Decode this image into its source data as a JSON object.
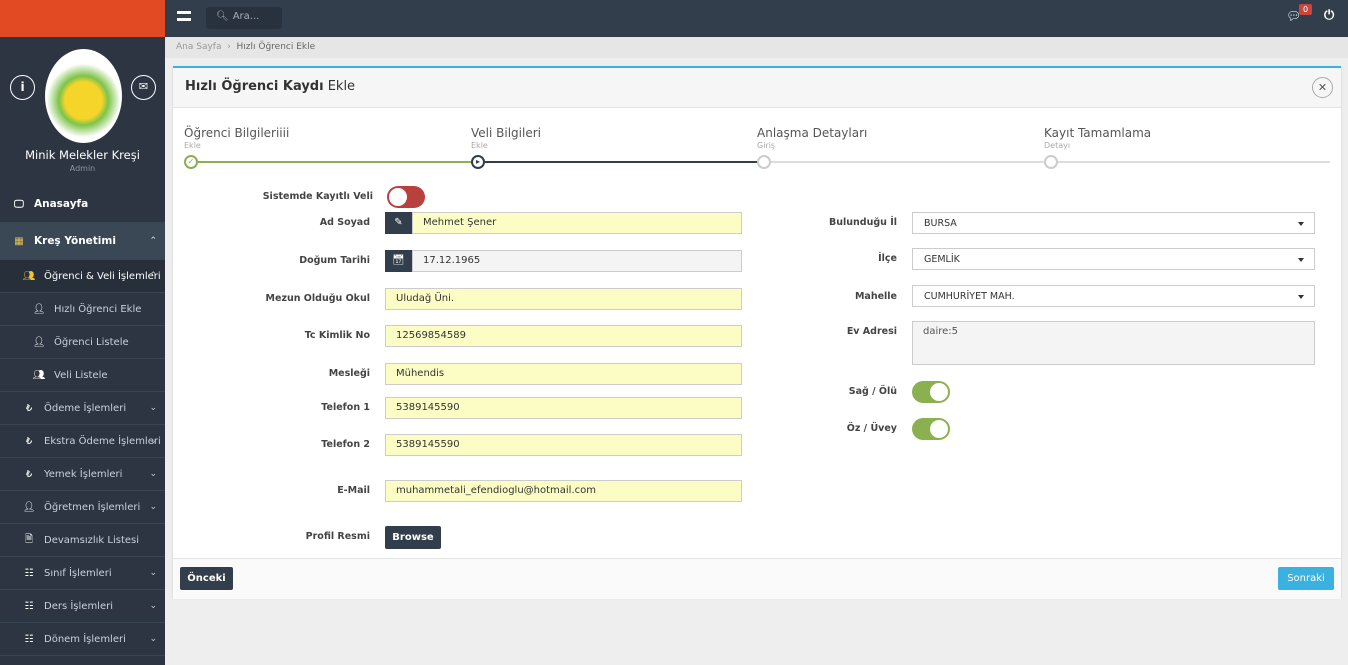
{
  "topbar": {
    "search_placeholder": "Ara...",
    "notification_count": "0"
  },
  "profile": {
    "name": "Minik Melekler Kreşi",
    "role": "Admin"
  },
  "sidebar": {
    "items": [
      {
        "label": "Anasayfa",
        "icon": "desktop-icon"
      },
      {
        "label": "Kreş Yönetimi",
        "icon": "building-icon"
      },
      {
        "label": "Öğrenci & Veli İşlemleri",
        "icon": "users-icon"
      },
      {
        "label": "Hızlı Öğrenci Ekle",
        "icon": "user-icon"
      },
      {
        "label": "Öğrenci Listele",
        "icon": "user-icon"
      },
      {
        "label": "Veli Listele",
        "icon": "users-icon"
      },
      {
        "label": "Ödeme İşlemleri",
        "icon": "lira-icon"
      },
      {
        "label": "Ekstra Ödeme İşlemleri",
        "icon": "lira-icon"
      },
      {
        "label": "Yemek İşlemleri",
        "icon": "lira-icon"
      },
      {
        "label": "Öğretmen İşlemleri",
        "icon": "user-icon"
      },
      {
        "label": "Devamsızlık Listesi",
        "icon": "file-icon"
      },
      {
        "label": "Sınıf İşlemleri",
        "icon": "sitemap-icon"
      },
      {
        "label": "Ders İşlemleri",
        "icon": "sitemap-icon"
      },
      {
        "label": "Dönem İşlemleri",
        "icon": "sitemap-icon"
      }
    ]
  },
  "breadcrumb": {
    "home": "Ana Sayfa",
    "current": "Hızlı Öğrenci Ekle"
  },
  "panel": {
    "title_bold": "Hızlı Öğrenci Kaydı",
    "title_rest": "Ekle"
  },
  "steps": [
    {
      "title": "Öğrenci Bilgileriiii",
      "sub": "Ekle",
      "state": "done"
    },
    {
      "title": "Veli Bilgileri",
      "sub": "Ekle",
      "state": "active"
    },
    {
      "title": "Anlaşma Detayları",
      "sub": "Giriş",
      "state": "pending"
    },
    {
      "title": "Kayıt Tamamlama",
      "sub": "Detayı",
      "state": "pending"
    }
  ],
  "form": {
    "registered_parent": {
      "label": "Sistemde Kayıtlı Veli",
      "on": false
    },
    "name": {
      "label": "Ad Soyad",
      "value": "Mehmet Şener"
    },
    "birth": {
      "label": "Doğum Tarihi",
      "value": "17.12.1965"
    },
    "school": {
      "label": "Mezun Olduğu Okul",
      "value": "Uludağ Üni."
    },
    "tc": {
      "label": "Tc Kimlik No",
      "value": "12569854589"
    },
    "job": {
      "label": "Mesleği",
      "value": "Mühendis"
    },
    "phone1": {
      "label": "Telefon 1",
      "value": "5389145590"
    },
    "phone2": {
      "label": "Telefon 2",
      "value": "5389145590"
    },
    "email": {
      "label": "E-Mail",
      "value": "muhammetali_efendioglu@hotmail.com"
    },
    "photo": {
      "label": "Profil Resmi",
      "button": "Browse"
    },
    "city": {
      "label": "Bulunduğu İl",
      "value": "BURSA"
    },
    "district": {
      "label": "İlçe",
      "value": "GEMLİK"
    },
    "neighborhood": {
      "label": "Mahelle",
      "value": "CUMHURİYET MAH."
    },
    "address": {
      "label": "Ev Adresi",
      "value": "daire:5"
    },
    "alive": {
      "label": "Sağ / Ölü",
      "on": true
    },
    "own": {
      "label": "Öz / Üvey",
      "on": true
    }
  },
  "footer": {
    "prev": "Önceki",
    "next": "Sonraki"
  },
  "colors": {
    "accent": "#3bb1e0",
    "brand": "#e24a24",
    "success": "#8bb04f",
    "danger": "#b8413e"
  }
}
